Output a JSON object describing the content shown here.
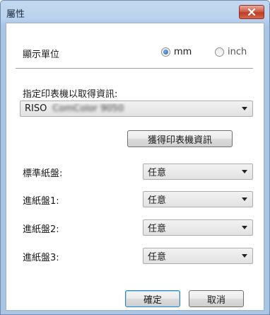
{
  "window": {
    "title": "屬性"
  },
  "units": {
    "label": "顯示單位",
    "options": [
      {
        "label": "mm",
        "selected": true
      },
      {
        "label": "inch",
        "selected": false
      }
    ]
  },
  "printer": {
    "label": "指定印表機以取得資訊:",
    "selected_prefix": "RISO",
    "selected_rest": "ComColor 9050",
    "get_info_button": "獲得印表機資訊"
  },
  "trays": [
    {
      "label": "標準紙盤:",
      "value": "任意"
    },
    {
      "label": "進紙盤1:",
      "value": "任意"
    },
    {
      "label": "進紙盤2:",
      "value": "任意"
    },
    {
      "label": "進紙盤3:",
      "value": "任意"
    }
  ],
  "footer": {
    "ok": "確定",
    "cancel": "取消"
  },
  "colors": {
    "title_bg": "#bcd3ef",
    "close_red": "#c13b22",
    "accent": "#3c7fb1"
  }
}
